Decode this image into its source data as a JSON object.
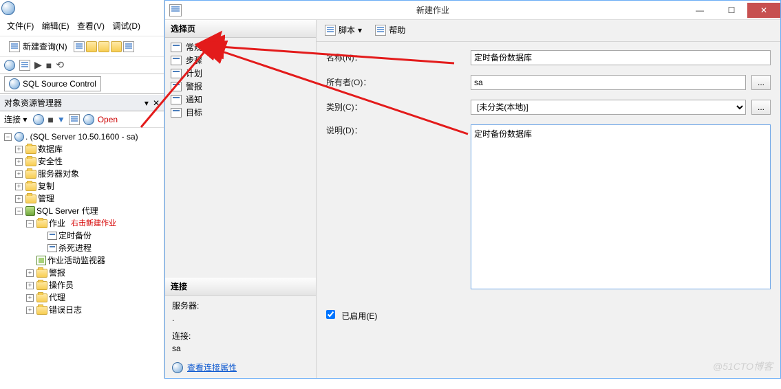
{
  "ssms": {
    "menus": {
      "file": "文件(F)",
      "edit": "编辑(E)",
      "view": "查看(V)",
      "debug": "调试(D)"
    },
    "new_query": "新建查询(N)",
    "source_control": "SQL Source Control",
    "obj_explorer_title": "对象资源管理器",
    "connect_label": "连接 ▾",
    "open_label": "Open",
    "root": ". (SQL Server 10.50.1600 - sa)",
    "nodes": {
      "databases": "数据库",
      "security": "安全性",
      "server_objects": "服务器对象",
      "replication": "复制",
      "management": "管理",
      "agent": "SQL Server 代理",
      "jobs": "作业",
      "job_note": "右击新建作业",
      "job1": "定时备份",
      "job2": "杀死进程",
      "activity_monitor": "作业活动监视器",
      "alerts": "警报",
      "operators": "操作员",
      "proxies": "代理",
      "error_logs": "错误日志"
    }
  },
  "dialog": {
    "title": "新建作业",
    "nav_section": "选择页",
    "nav": {
      "general": "常规",
      "steps": "步骤",
      "schedules": "计划",
      "alerts": "警报",
      "notifications": "通知",
      "targets": "目标"
    },
    "toolbar": {
      "script": "脚本",
      "help": "帮助"
    },
    "labels": {
      "name": "名称(N)：",
      "owner": "所有者(O)：",
      "category": "类别(C)：",
      "description": "说明(D)：",
      "enabled": "已启用(E)"
    },
    "values": {
      "name": "定时备份数据库",
      "owner": "sa",
      "category": "[未分类(本地)]",
      "description": "定时备份数据库"
    },
    "browse": "...",
    "conn_section": "连接",
    "conn": {
      "server_label": "服务器:",
      "server_value": ".",
      "conn_label": "连接:",
      "conn_value": "sa",
      "view_props": "查看连接属性"
    }
  },
  "watermark": "@51CTO博客"
}
